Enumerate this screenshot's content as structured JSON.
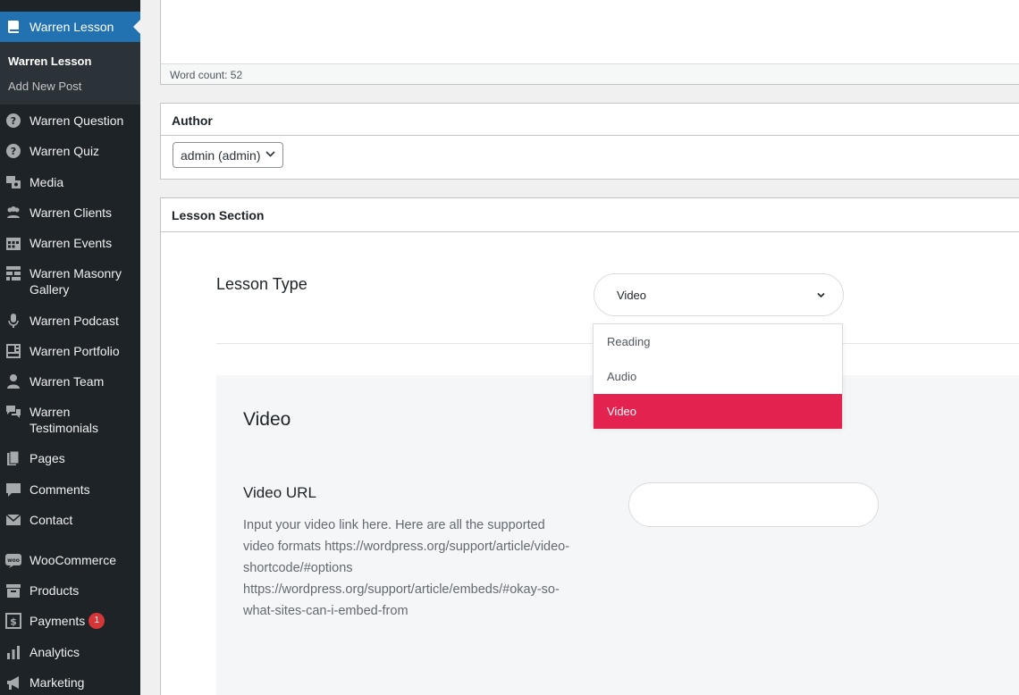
{
  "sidebar": {
    "active_menu": "Warren Lesson",
    "submenu": [
      "Warren Lesson",
      "Add New Post"
    ],
    "items": [
      {
        "label": "Warren Question",
        "icon": "question-icon"
      },
      {
        "label": "Warren Quiz",
        "icon": "question-icon"
      },
      {
        "label": "Media",
        "icon": "media-icon"
      },
      {
        "label": "Warren Clients",
        "icon": "clients-icon"
      },
      {
        "label": "Warren Events",
        "icon": "calendar-icon"
      },
      {
        "label": "Warren Masonry Gallery",
        "icon": "gallery-grid-icon"
      },
      {
        "label": "Warren Podcast",
        "icon": "microphone-icon"
      },
      {
        "label": "Warren Portfolio",
        "icon": "portfolio-icon"
      },
      {
        "label": "Warren Team",
        "icon": "person-icon"
      },
      {
        "label": "Warren Testimonials",
        "icon": "speech-bubbles-icon"
      },
      {
        "label": "Pages",
        "icon": "pages-icon"
      },
      {
        "label": "Comments",
        "icon": "comment-icon"
      },
      {
        "label": "Contact",
        "icon": "envelope-icon"
      },
      {
        "label": "WooCommerce",
        "icon": "woocommerce-icon"
      },
      {
        "label": "Products",
        "icon": "archive-box-icon"
      },
      {
        "label": "Payments",
        "icon": "dollar-icon",
        "badge": "1"
      },
      {
        "label": "Analytics",
        "icon": "bar-chart-icon"
      },
      {
        "label": "Marketing",
        "icon": "megaphone-icon"
      }
    ]
  },
  "editor": {
    "word_count": "Word count: 52"
  },
  "author": {
    "title": "Author",
    "selected": "admin (admin)"
  },
  "lesson": {
    "title": "Lesson Section",
    "type_label": "Lesson Type",
    "type_selected": "Video",
    "options": [
      "Reading",
      "Audio",
      "Video"
    ],
    "selected_option_color": "#e3224f",
    "video_title": "Video",
    "video_url_label": "Video URL",
    "video_url_desc": "Input your video link here. Here are all the supported video formats https://wordpress.org/support/article/video-shortcode/#options https://wordpress.org/support/article/embeds/#okay-so-what-sites-can-i-embed-from",
    "video_url_value": ""
  },
  "colors": {
    "sidebar_bg": "#1d2327",
    "active_menu_bg": "#2271b1",
    "badge": "#d63638"
  }
}
